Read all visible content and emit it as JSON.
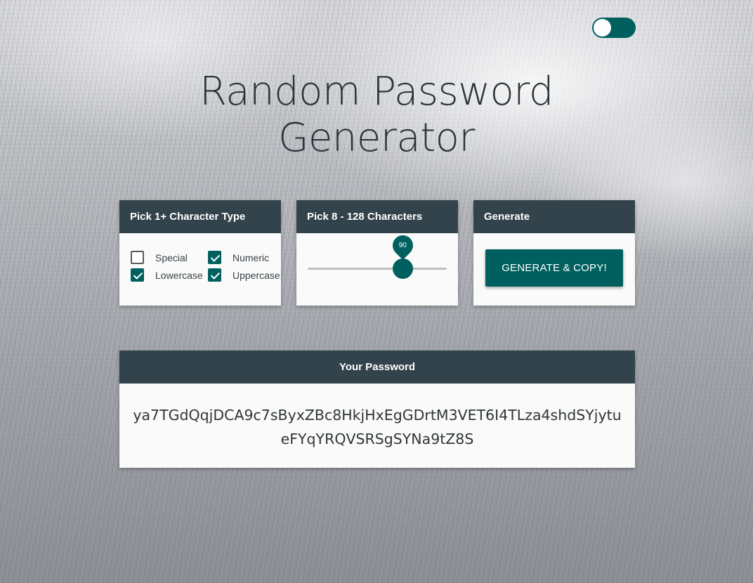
{
  "theme_toggle": {
    "state": "on"
  },
  "title": "Random Password Generator",
  "character_types": {
    "header": "Pick 1+ Character Type",
    "options": [
      {
        "label": "Special",
        "checked": false
      },
      {
        "label": "Numeric",
        "checked": true
      },
      {
        "label": "Lowercase",
        "checked": true
      },
      {
        "label": "Uppercase",
        "checked": true
      }
    ]
  },
  "length": {
    "header": "Pick 8 - 128 Characters",
    "min": 8,
    "max": 128,
    "value": 90,
    "value_label": "90"
  },
  "generate": {
    "header": "Generate",
    "button_label": "GENERATE & COPY!"
  },
  "password": {
    "header": "Your Password",
    "value": "ya7TGdQqjDCA9c7sByxZBc8HkjHxEgGDrtM3VET6I4TLza4shdSYjytueFYqYRQVSRSgSYNa9tZ8S"
  },
  "colors": {
    "accent": "#00605f",
    "header_bg": "#33434b",
    "card_bg": "#fafafa"
  }
}
